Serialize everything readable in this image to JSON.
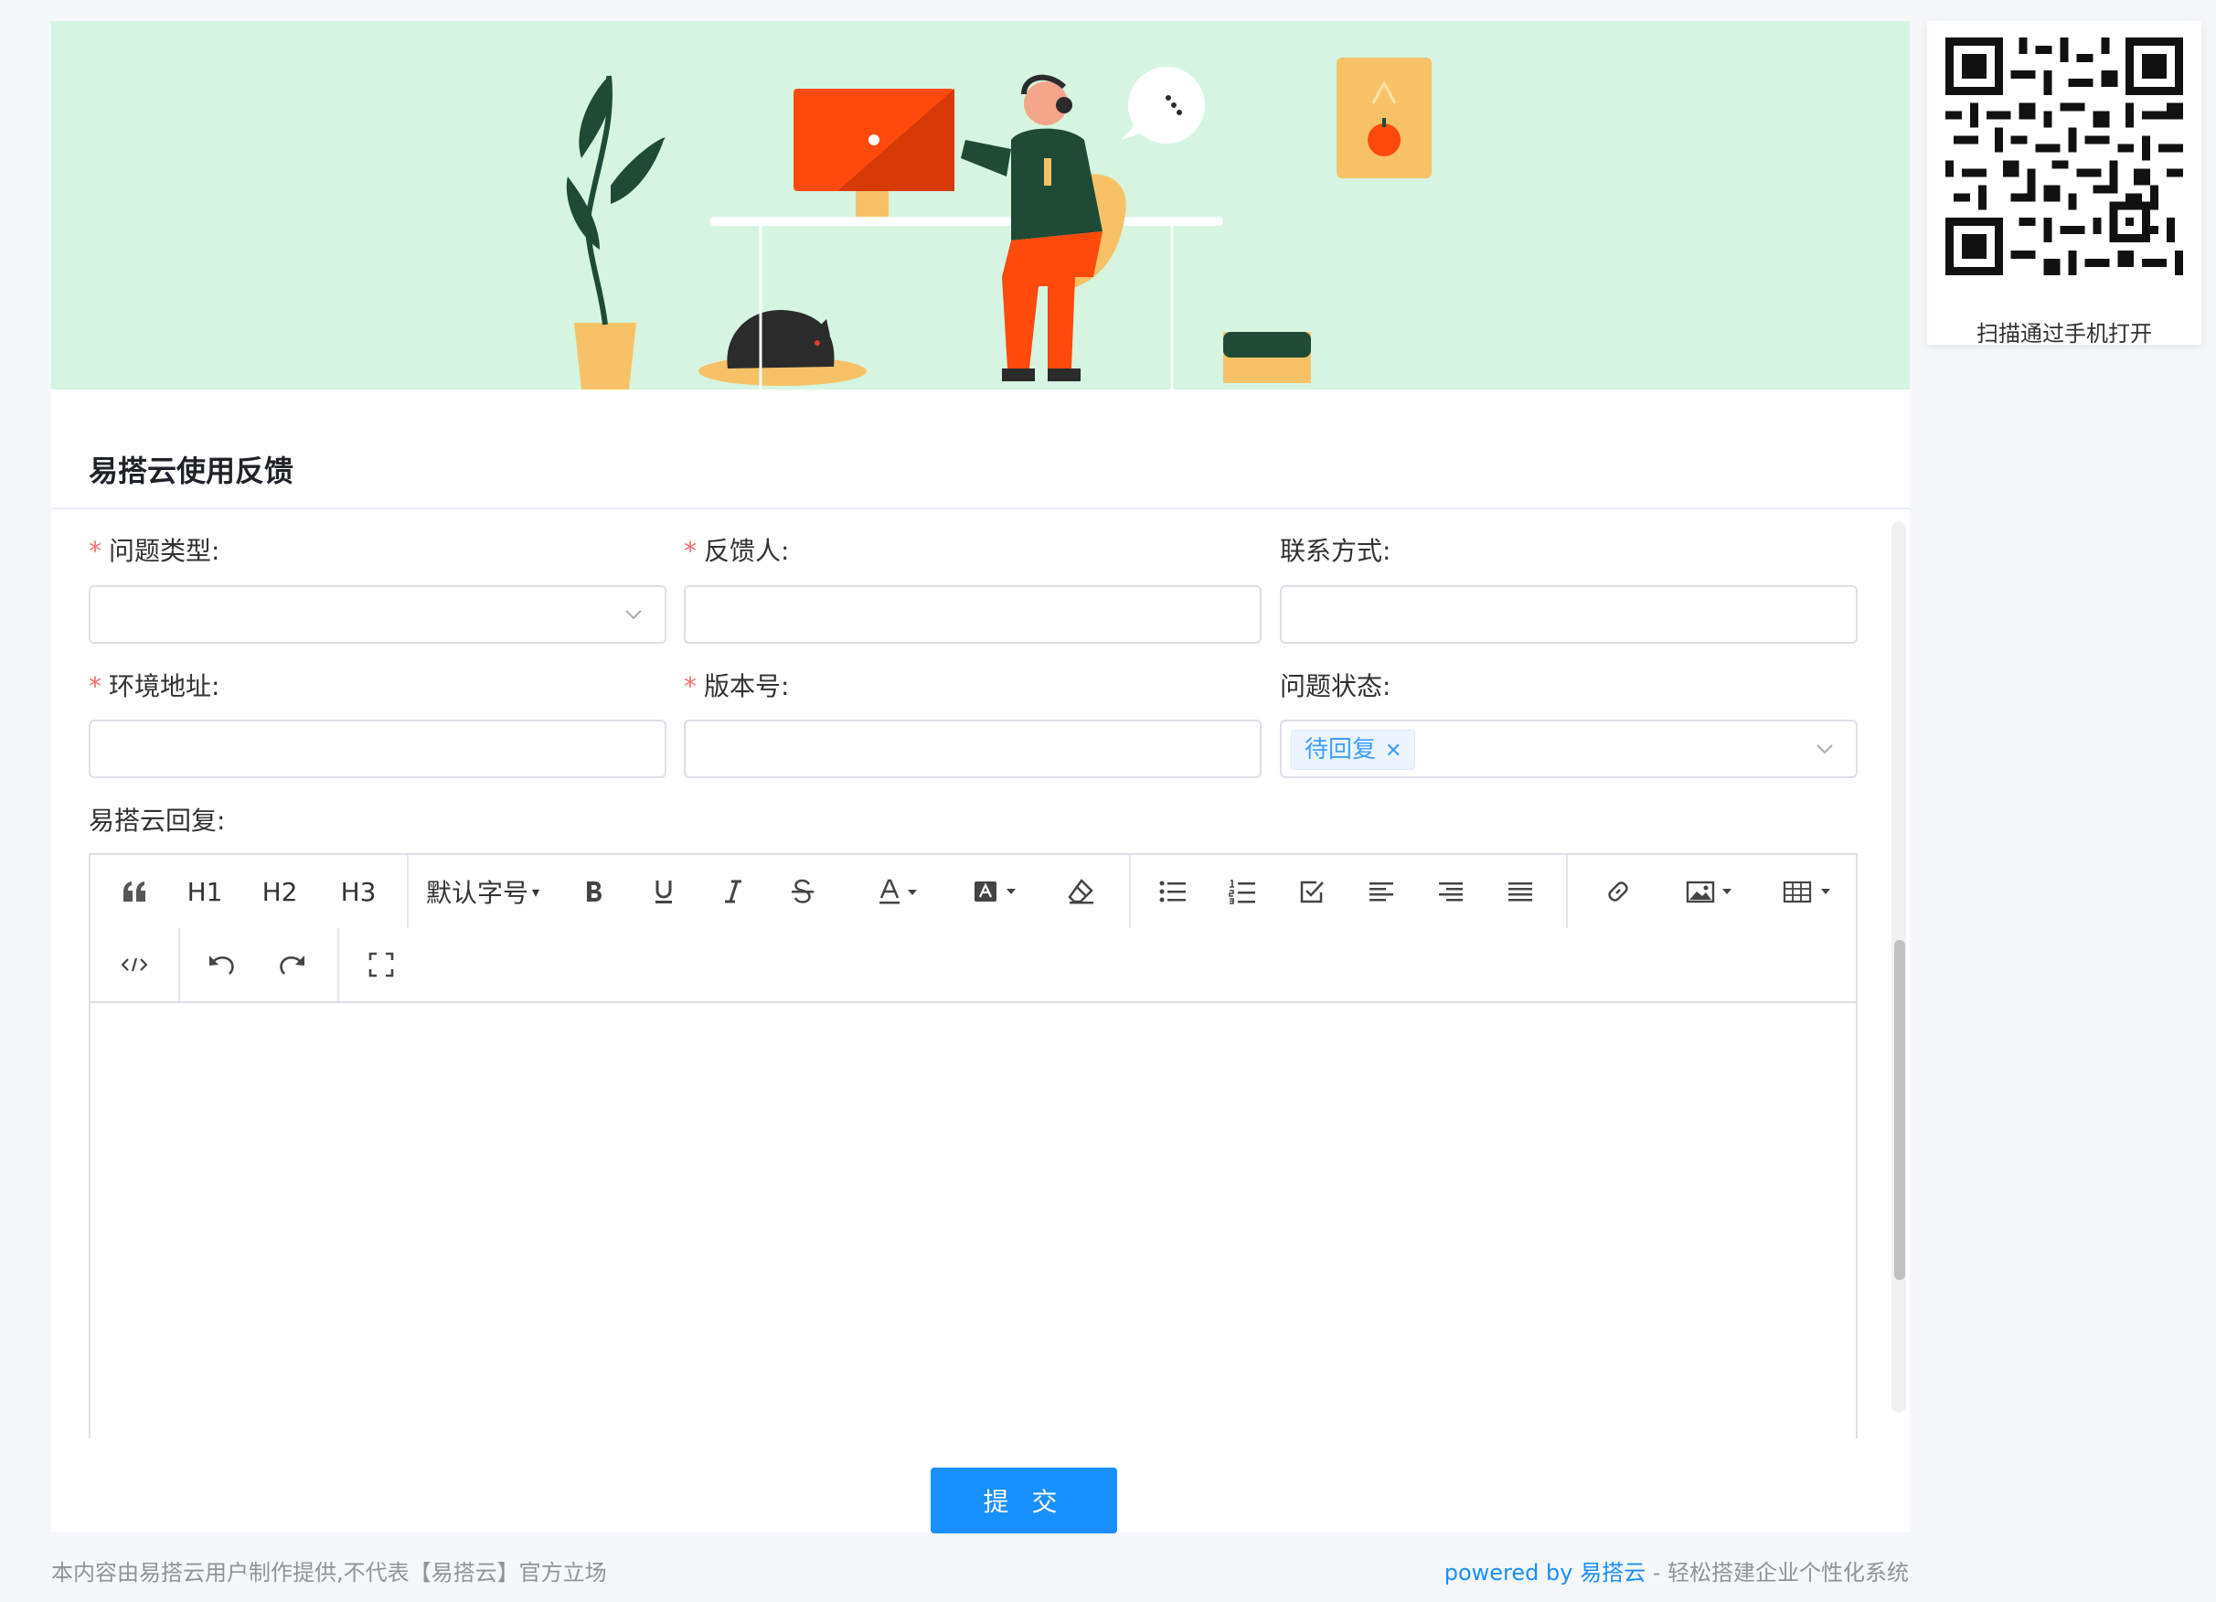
{
  "form": {
    "title": "易搭云使用反馈",
    "fields": {
      "problem_type": {
        "label": "问题类型:",
        "required": true,
        "value": ""
      },
      "feedback_person": {
        "label": "反馈人:",
        "required": true,
        "value": ""
      },
      "contact": {
        "label": "联系方式:",
        "required": false,
        "value": ""
      },
      "env_address": {
        "label": "环境地址:",
        "required": true,
        "value": ""
      },
      "version": {
        "label": "版本号:",
        "required": true,
        "value": ""
      },
      "problem_status": {
        "label": "问题状态:",
        "required": false,
        "tag": "待回复"
      },
      "reply": {
        "label": "易搭云回复:"
      }
    },
    "required_mark": "*"
  },
  "editor": {
    "toolbar": {
      "h1": "H1",
      "h2": "H2",
      "h3": "H3",
      "font_size": "默认字号",
      "font_size_caret": "▾"
    },
    "content": ""
  },
  "submit_label": "提 交",
  "footer": {
    "disclaimer": "本内容由易搭云用户制作提供,不代表【易搭云】官方立场",
    "powered_by": "powered by",
    "brand": "易搭云",
    "slogan": " - 轻松搭建企业个性化系统"
  },
  "qr": {
    "caption": "扫描通过手机打开"
  },
  "colors": {
    "accent": "#1890ff",
    "required": "#f56c6c",
    "banner_bg": "#d5f5e1"
  }
}
